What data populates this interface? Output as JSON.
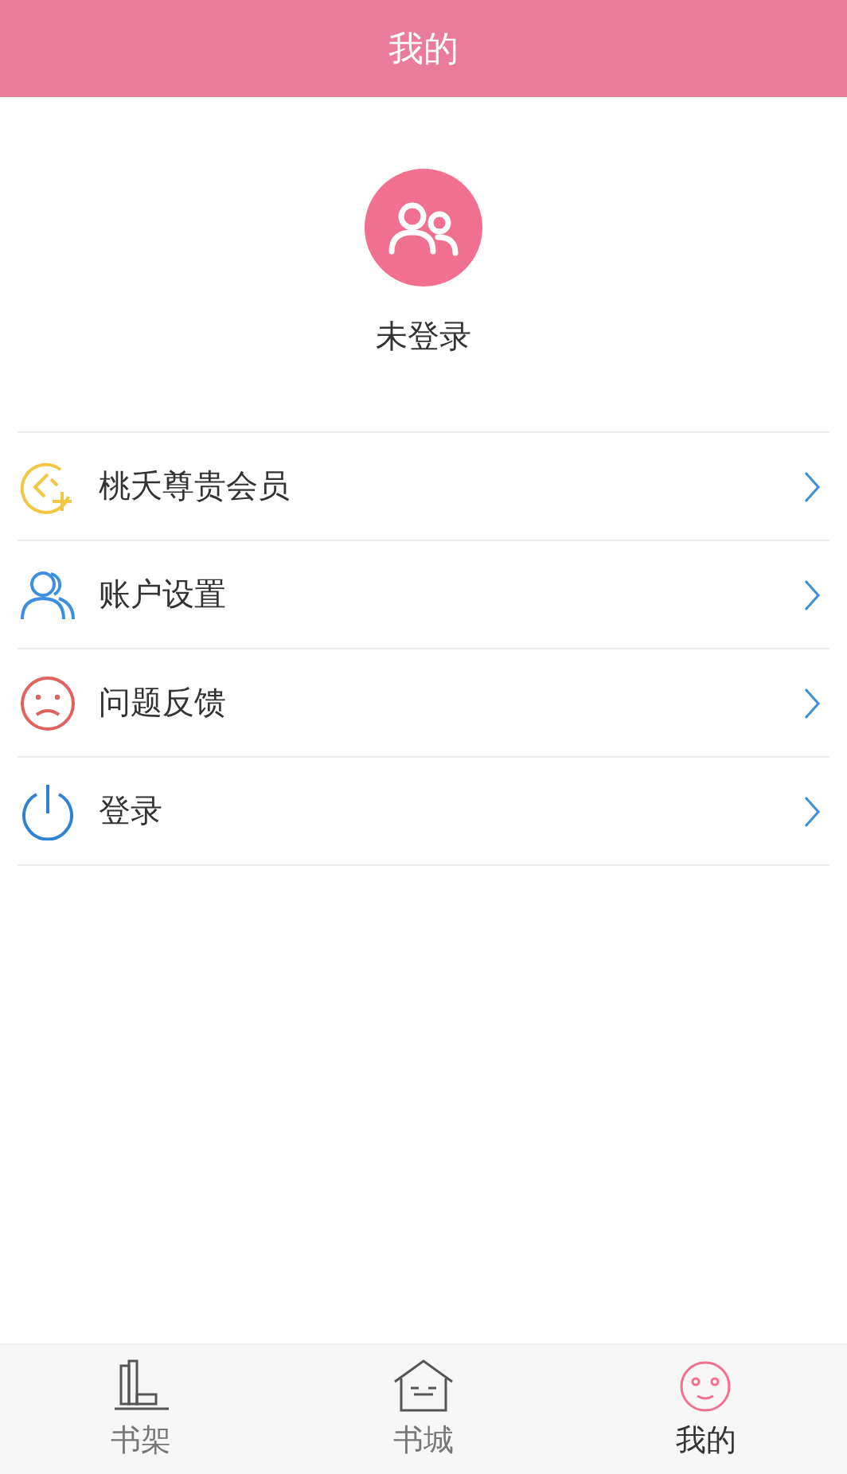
{
  "header": {
    "title": "我的"
  },
  "profile": {
    "name": "未登录"
  },
  "menu": [
    {
      "label": "桃夭尊贵会员",
      "kind": "vip"
    },
    {
      "label": "账户设置",
      "kind": "account"
    },
    {
      "label": "问题反馈",
      "kind": "feedback"
    },
    {
      "label": "登录",
      "kind": "power"
    }
  ],
  "tabs": [
    {
      "label": "书架",
      "kind": "shelf",
      "selected": false
    },
    {
      "label": "书城",
      "kind": "store",
      "selected": false
    },
    {
      "label": "我的",
      "kind": "me",
      "selected": true
    }
  ]
}
